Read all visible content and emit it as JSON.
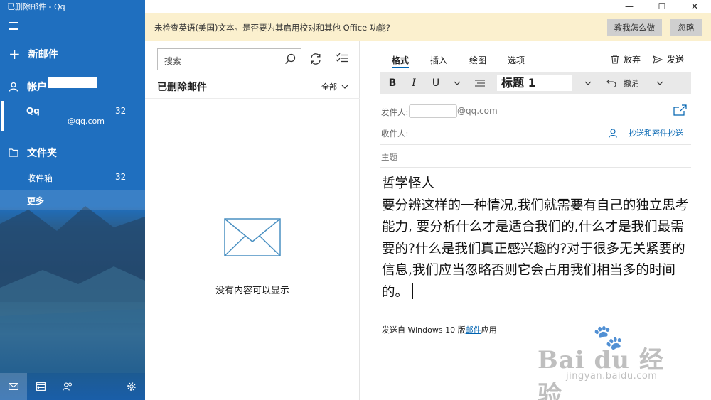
{
  "window": {
    "title": "已删除邮件 - Qq",
    "controls": [
      "—",
      "☐",
      "✕"
    ]
  },
  "sidebar": {
    "new_mail": "新邮件",
    "accounts_label": "帐户",
    "account": {
      "name": "Qq",
      "count": "32",
      "email_suffix": "@qq.com"
    },
    "folders_label": "文件夹",
    "inbox": {
      "label": "收件箱",
      "count": "32"
    },
    "more": "更多"
  },
  "banner": {
    "text": "未检查英语(美国)文本。是否要为其启用校对和其他 Office 功能?",
    "teach_button": "教我怎么做",
    "ignore_button": "忽略"
  },
  "list": {
    "search_placeholder": "搜索",
    "folder_title": "已删除邮件",
    "filter": "全部",
    "empty_message": "没有内容可以显示"
  },
  "compose": {
    "tabs": [
      "格式",
      "插入",
      "绘图",
      "选项"
    ],
    "discard": "放弃",
    "send": "发送",
    "format": {
      "bold": "B",
      "italic": "I",
      "underline": "U",
      "style": "标题 1",
      "undo": "撤消"
    },
    "from_label": "发件人:",
    "from_domain": "@qq.com",
    "to_label": "收件人:",
    "cc_bcc": "抄送和密件抄送",
    "subject_placeholder": "主题",
    "body_title": "哲学怪人",
    "body_paragraph": "要分辨这样的一种情况,我们就需要有自己的独立思考能力, 要分析什么才是适合我们的,什么才是我们最需要的?什么是我们真正感兴趣的?对于很多无关紧要的信息,我们应当忽略否则它会占用我们相当多的时间的。",
    "signature_prefix": "发送自 Windows 10 版",
    "signature_link": "邮件",
    "signature_suffix": "应用"
  },
  "watermark": {
    "logo": "Bai du 经验",
    "url": "jingyan.baidu.com"
  },
  "colors": {
    "sidebar_blue": "#1f6fbf",
    "banner_yellow": "#fbf0ce",
    "accent": "#0063b1"
  }
}
